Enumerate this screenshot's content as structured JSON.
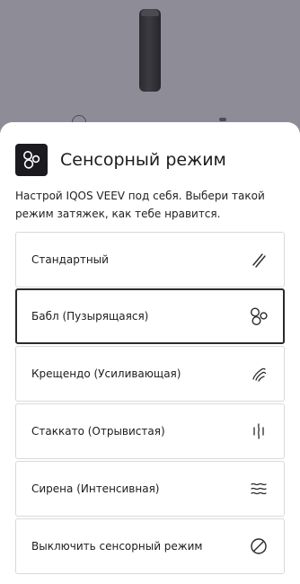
{
  "sheet": {
    "title": "Сенсорный режим",
    "description": "Настрой IQOS VEEV под себя. Выбери такой режим затяжек, как тебе нравится.",
    "icon": "bubbles-icon"
  },
  "options": [
    {
      "label": "Стандартный",
      "icon": "double-slash-icon",
      "selected": false
    },
    {
      "label": "Бабл (Пузырящаяся)",
      "icon": "bubbles-icon",
      "selected": true
    },
    {
      "label": "Крещендо (Усиливающая)",
      "icon": "crescendo-waves-icon",
      "selected": false
    },
    {
      "label": "Стаккато (Отрывистая)",
      "icon": "staccato-lines-icon",
      "selected": false
    },
    {
      "label": "Сирена (Интенсивная)",
      "icon": "wavy-lines-icon",
      "selected": false
    },
    {
      "label": "Выключить сенсорный режим",
      "icon": "prohibited-icon",
      "selected": false
    }
  ],
  "colors": {
    "backdrop": "#8e8d97",
    "badge": "#1b1b1f",
    "selected_border": "#2a2a2e",
    "option_border": "#d9d9dc"
  }
}
